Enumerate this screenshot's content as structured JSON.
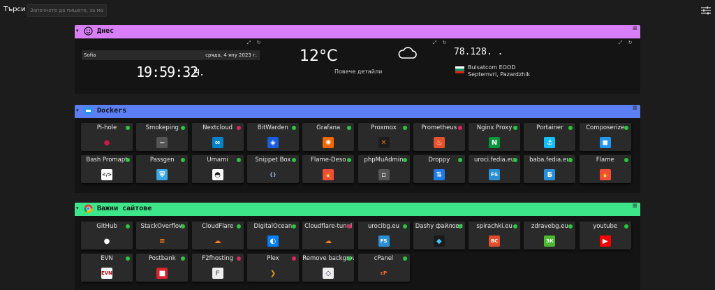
{
  "search": {
    "label": "Търси",
    "placeholder": "Започнете да пишете, за ма"
  },
  "sections": {
    "today": {
      "title": "Днес",
      "color": "#d87ef7",
      "datetime": {
        "city": "Sofia",
        "date": "сряда, 4 яну 2023 г.",
        "time": "19:59:32",
        "unit": "ч."
      },
      "weather": {
        "temperature": "12°C",
        "more": "Повече детайли",
        "icon": "cloud-icon"
      },
      "ip": {
        "address": "78.128.  .",
        "isp": "Bulsatcom EOOD",
        "location": "Septemvri, Pazardzhik"
      }
    },
    "dockers": {
      "title": "Dockers",
      "color": "#5b7ef5",
      "tiles": [
        {
          "name": "Pi-hole",
          "status": "green",
          "icon": "raspberry-icon"
        },
        {
          "name": "Smokeping",
          "status": "green",
          "icon": "smokeping-icon"
        },
        {
          "name": "Nextcloud",
          "status": "red",
          "icon": "nextcloud-icon"
        },
        {
          "name": "BitWarden",
          "status": "green",
          "icon": "bitwarden-icon"
        },
        {
          "name": "Grafana",
          "status": "green",
          "icon": "grafana-icon"
        },
        {
          "name": "Proxmox",
          "status": "green",
          "icon": "proxmox-icon"
        },
        {
          "name": "Prometheus",
          "status": "red",
          "icon": "prometheus-icon"
        },
        {
          "name": "Nginx Proxy",
          "status": "green",
          "icon": "nginx-icon"
        },
        {
          "name": "Portainer",
          "status": "green",
          "icon": "portainer-icon"
        },
        {
          "name": "Composerize",
          "status": "green",
          "icon": "docker-icon"
        },
        {
          "name": "Bash Promapt",
          "status": "green",
          "icon": "code-icon"
        },
        {
          "name": "Passgen",
          "status": "green",
          "icon": "shield-icon"
        },
        {
          "name": "Umami",
          "status": "green",
          "icon": "umami-icon"
        },
        {
          "name": "Snippet Box",
          "status": "green",
          "icon": "braces-icon"
        },
        {
          "name": "Flame-Deso",
          "status": "green",
          "icon": "flame-icon"
        },
        {
          "name": "phpMuAdmin",
          "status": "green",
          "icon": "broken-image-icon"
        },
        {
          "name": "Droppy",
          "status": "green",
          "icon": "upload-icon"
        },
        {
          "name": "uroci.fedia.eu",
          "status": "green",
          "icon": "fs-icon"
        },
        {
          "name": "baba.fedia.eu",
          "status": "green",
          "icon": "b-icon"
        },
        {
          "name": "Flame",
          "status": "green",
          "icon": "flame-icon"
        }
      ]
    },
    "sites": {
      "title": "Важни сайтове",
      "color": "#3ee68a",
      "tiles": [
        {
          "name": "GitHub",
          "status": "green",
          "icon": "github-icon"
        },
        {
          "name": "StackOverflow",
          "status": "green",
          "icon": "stackoverflow-icon"
        },
        {
          "name": "CloudFlare",
          "status": "green",
          "icon": "cloudflare-icon"
        },
        {
          "name": "DigitalOcean",
          "status": "green",
          "icon": "digitalocean-icon"
        },
        {
          "name": "Cloudflare-tunel",
          "status": "red",
          "icon": "cloudflare-icon"
        },
        {
          "name": "urocibg.eu",
          "status": "green",
          "icon": "fs-icon"
        },
        {
          "name": "Dashy файлове",
          "status": "green",
          "icon": "dashy-icon"
        },
        {
          "name": "spirachki.eu",
          "status": "green",
          "icon": "bc-icon"
        },
        {
          "name": "zdravebg.eu",
          "status": "green",
          "icon": "zk-icon"
        },
        {
          "name": "youtube",
          "status": "green",
          "icon": "youtube-icon"
        },
        {
          "name": "EVN",
          "status": "green",
          "icon": "evn-icon"
        },
        {
          "name": "Postbank",
          "status": "green",
          "icon": "postbank-icon"
        },
        {
          "name": "F2fhosting",
          "status": "red",
          "icon": "f2f-icon"
        },
        {
          "name": "Plex",
          "status": "red",
          "icon": "plex-icon"
        },
        {
          "name": "Remove background",
          "status": "green",
          "icon": "layers-icon"
        },
        {
          "name": "cPanel",
          "status": "green",
          "icon": "cpanel-icon"
        }
      ]
    }
  },
  "colors": {
    "green": "#27c93f",
    "red": "#e0245e"
  }
}
